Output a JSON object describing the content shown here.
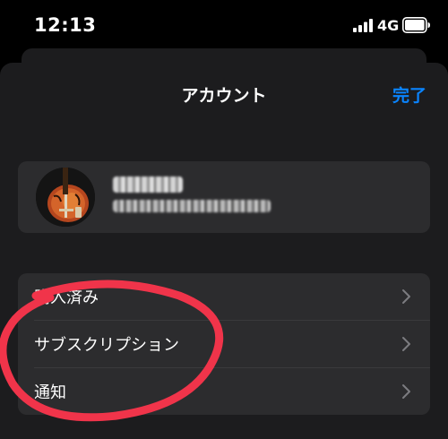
{
  "status_bar": {
    "time": "12:13",
    "network": "4G",
    "signal_icon": "cellular-signal-icon",
    "battery_icon": "battery-icon"
  },
  "header": {
    "title": "アカウント",
    "done_label": "完了"
  },
  "profile": {
    "avatar_icon": "guitar-avatar-image"
  },
  "menu": {
    "items": [
      {
        "label": "購入済み",
        "chevron_icon": "chevron-right-icon"
      },
      {
        "label": "サブスクリプション",
        "chevron_icon": "chevron-right-icon"
      },
      {
        "label": "通知",
        "chevron_icon": "chevron-right-icon"
      }
    ]
  },
  "colors": {
    "accent": "#0a84ff",
    "annotation": "#f0344a",
    "background": "#000000",
    "sheet": "#1c1c1e",
    "card": "#2c2c2e"
  }
}
